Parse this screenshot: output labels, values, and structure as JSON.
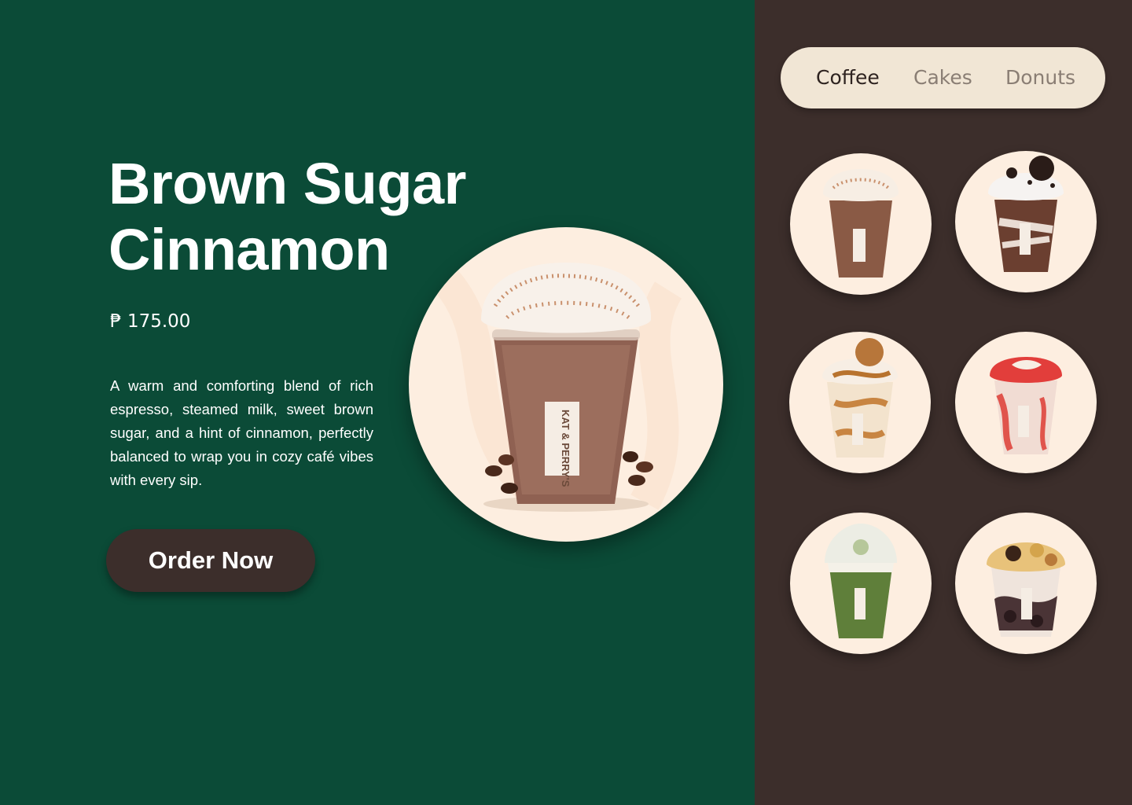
{
  "product": {
    "title_line1": "Brown Sugar",
    "title_line2": "Cinnamon",
    "price": "₱ 175.00",
    "description": "A warm and comforting blend of rich espresso, steamed milk, sweet brown sugar, and a hint of cinnamon, perfectly balanced to wrap you in cozy café vibes with every sip.",
    "order_label": "Order Now",
    "cup_brand": "KAT & PERRY'S"
  },
  "tabs": [
    {
      "label": "Coffee",
      "active": true
    },
    {
      "label": "Cakes",
      "active": false
    },
    {
      "label": "Donuts",
      "active": false
    }
  ],
  "menu_items": [
    {
      "name": "brown-sugar-cinnamon-drink",
      "drink_color": "#8a5a45",
      "topping": "whipped-cinnamon"
    },
    {
      "name": "cookies-and-cream-drink",
      "drink_color": "#6b3f30",
      "topping": "cookie-crumble"
    },
    {
      "name": "biscoff-caramel-drink",
      "drink_color": "#d8a672",
      "topping": "biscoff-caramel"
    },
    {
      "name": "strawberry-drink",
      "drink_color": "#e89a96",
      "topping": "strawberry-syrup"
    },
    {
      "name": "matcha-drink",
      "drink_color": "#5f7f3a",
      "topping": "matcha-foam"
    },
    {
      "name": "ube-halo-drink",
      "drink_color": "#4a3436",
      "topping": "fruit-mix"
    }
  ],
  "colors": {
    "left_bg": "#0b4b37",
    "right_bg": "#3c2e2b",
    "circle_bg": "#fdeee0",
    "tab_bg": "#f1e6d5",
    "button_bg": "#3c2e2b"
  }
}
